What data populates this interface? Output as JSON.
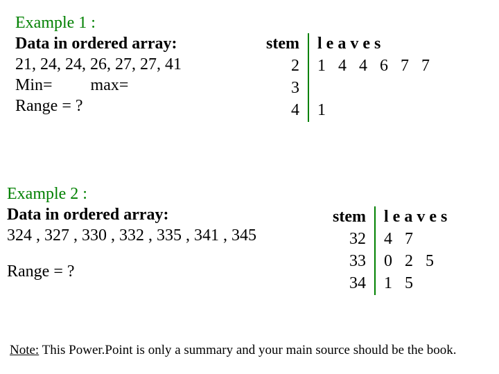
{
  "ex1": {
    "title": "Example 1 :",
    "subtitle": "Data in ordered array:",
    "data_line": "21, 24, 24, 26, 27, 27, 41",
    "min_label": "Min=",
    "max_label": "max=",
    "range_label": "Range = ?"
  },
  "sl1": {
    "stem_header": "stem",
    "leaves_header": "leaves",
    "rows": [
      {
        "stem": "2",
        "leaves": "1 4 4 6 7 7"
      },
      {
        "stem": "3",
        "leaves": ""
      },
      {
        "stem": "4",
        "leaves": "1"
      }
    ]
  },
  "ex2": {
    "title": "Example 2 :",
    "subtitle": "Data in ordered array:",
    "data_line": "324 , 327 , 330 , 332 , 335 , 341 , 345",
    "range_label": "Range = ?"
  },
  "sl2": {
    "stem_header": "stem",
    "leaves_header": "leaves",
    "rows": [
      {
        "stem": "32",
        "leaves": "4 7"
      },
      {
        "stem": "33",
        "leaves": "0 2 5"
      },
      {
        "stem": "34",
        "leaves": "1 5"
      }
    ]
  },
  "note": {
    "label": "Note:",
    "text": " This Power.Point is only a summary and your main source should be the book."
  },
  "chart_data": [
    {
      "type": "table",
      "title": "Example 1 stem-and-leaf",
      "stems": [
        2,
        3,
        4
      ],
      "leaves": [
        [
          1,
          4,
          4,
          6,
          7,
          7
        ],
        [],
        [
          1
        ]
      ],
      "raw_values": [
        21,
        24,
        24,
        26,
        27,
        27,
        41
      ]
    },
    {
      "type": "table",
      "title": "Example 2 stem-and-leaf",
      "stems": [
        32,
        33,
        34
      ],
      "leaves": [
        [
          4,
          7
        ],
        [
          0,
          2,
          5
        ],
        [
          1,
          5
        ]
      ],
      "raw_values": [
        324,
        327,
        330,
        332,
        335,
        341,
        345
      ]
    }
  ]
}
